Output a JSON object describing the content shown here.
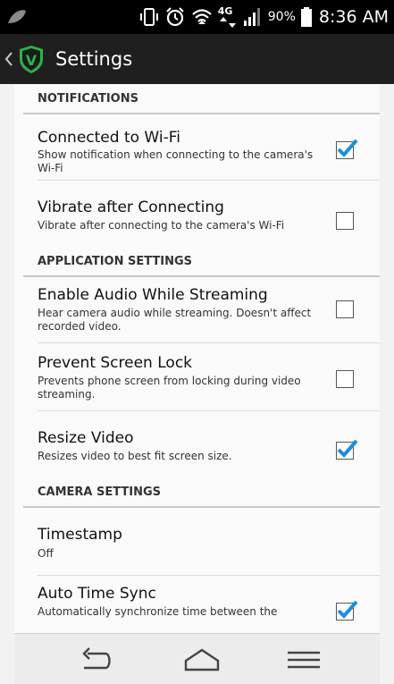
{
  "status_bar": {
    "battery_percent": "90%",
    "time": "8:36 AM",
    "network_type": "4G",
    "icons": [
      "leaf-icon",
      "vibrate-icon",
      "alarm-icon",
      "wifi-icon",
      "4g-icon",
      "signal-icon",
      "battery-icon"
    ]
  },
  "action_bar": {
    "title": "Settings",
    "logo_letter": "V",
    "icons": [
      "back-caret-icon",
      "app-shield-logo-icon"
    ]
  },
  "sections": [
    {
      "header": "NOTIFICATIONS",
      "items": [
        {
          "title": "Connected to Wi-Fi",
          "summary": "Show notification when connecting to the camera's Wi-Fi",
          "checked": true
        },
        {
          "title": "Vibrate after Connecting",
          "summary": "Vibrate after connecting to the camera's Wi-Fi",
          "checked": false
        }
      ]
    },
    {
      "header": "APPLICATION SETTINGS",
      "items": [
        {
          "title": "Enable Audio While Streaming",
          "summary": "Hear camera audio while streaming. Doesn't affect recorded video.",
          "checked": false
        },
        {
          "title": "Prevent Screen Lock",
          "summary": "Prevents phone screen from locking during video streaming.",
          "checked": false
        },
        {
          "title": "Resize Video",
          "summary": "Resizes video to best fit screen size.",
          "checked": true
        }
      ]
    },
    {
      "header": "CAMERA SETTINGS",
      "items": [
        {
          "title": "Timestamp",
          "summary": "Off"
        },
        {
          "title": "Auto Time Sync",
          "summary": "Automatically synchronize time between the",
          "checked": true
        }
      ]
    }
  ],
  "colors": {
    "checkmark": "#1a8fe0",
    "logo_green": "#2db24a",
    "status_bar_bg": "#000000",
    "action_bar_bg": "#1f1f1f"
  },
  "nav_bar": {
    "icons": [
      "back-arrow-icon",
      "home-icon",
      "menu-icon"
    ]
  }
}
